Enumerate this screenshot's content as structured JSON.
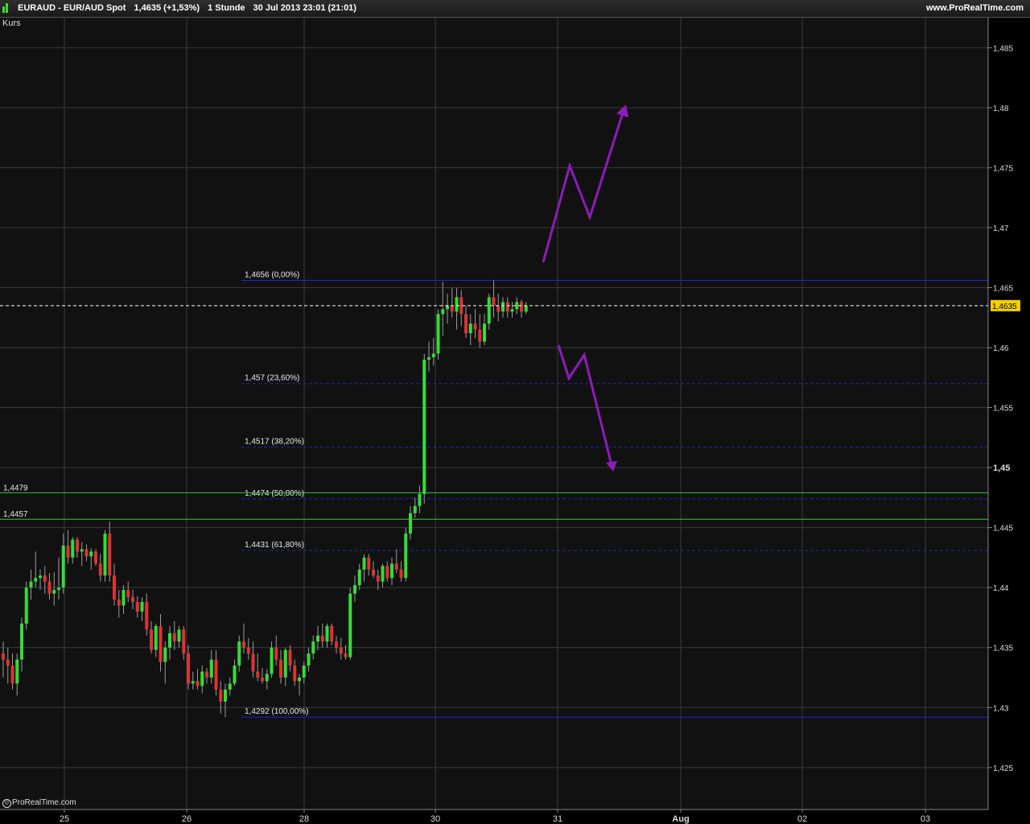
{
  "header": {
    "symbol": "EURAUD - EUR/AUD Spot",
    "last": "1,4635 (+1,53%)",
    "interval": "1 Stunde",
    "datetime": "30 Jul 2013 23:01 (21:01)",
    "site": "www.ProRealTime.com"
  },
  "panel_label": "Kurs",
  "watermark": "ProRealTime.com",
  "colors": {
    "up": "#33dd33",
    "down": "#dd3333",
    "fib": "#2222cc",
    "support": "#33cc33",
    "arrow": "#8c1cb8",
    "price_tag": "#f5d000"
  },
  "chart_data": {
    "type": "candlestick",
    "title": "EURAUD - EUR/AUD Spot",
    "ylabel": "Kurs",
    "ylim": [
      1.4215,
      1.4875
    ],
    "yticks": [
      "1,485",
      "1,48",
      "1,475",
      "1,47",
      "1,465",
      "1,46",
      "1,455",
      "1,45",
      "1,445",
      "1,44",
      "1,435",
      "1,43",
      "1,425"
    ],
    "ytick_values": [
      1.485,
      1.48,
      1.475,
      1.47,
      1.465,
      1.46,
      1.455,
      1.45,
      1.445,
      1.44,
      1.435,
      1.43,
      1.425
    ],
    "xticks": [
      "25",
      "26",
      "28",
      "30",
      "31",
      "Aug",
      "02",
      "03"
    ],
    "last_price": "1,4635",
    "last_price_value": 1.4635,
    "support_lines": [
      {
        "label": "1,4479",
        "value": 1.4479
      },
      {
        "label": "1,4457",
        "value": 1.4457
      }
    ],
    "fib_levels": [
      {
        "label": "1,4656 (0,00%)",
        "value": 1.4656
      },
      {
        "label": "1,457 (23,60%)",
        "value": 1.457
      },
      {
        "label": "1,4517 (38,20%)",
        "value": 1.4517
      },
      {
        "label": "1,4474 (50,00%)",
        "value": 1.4474
      },
      {
        "label": "1,4431 (61,80%)",
        "value": 1.4431
      },
      {
        "label": "1,4292 (100,00%)",
        "value": 1.4292
      }
    ],
    "candles": [
      [
        1.4345,
        1.4355,
        1.4325,
        1.434
      ],
      [
        1.434,
        1.435,
        1.432,
        1.4335
      ],
      [
        1.4335,
        1.4345,
        1.4315,
        1.432
      ],
      [
        1.432,
        1.4345,
        1.431,
        1.434
      ],
      [
        1.434,
        1.4375,
        1.433,
        1.437
      ],
      [
        1.437,
        1.4405,
        1.4365,
        1.44
      ],
      [
        1.44,
        1.4415,
        1.439,
        1.4405
      ],
      [
        1.4405,
        1.443,
        1.44,
        1.4408
      ],
      [
        1.4408,
        1.4415,
        1.4398,
        1.441
      ],
      [
        1.441,
        1.4418,
        1.4395,
        1.4405
      ],
      [
        1.4405,
        1.4412,
        1.439,
        1.4395
      ],
      [
        1.4395,
        1.4413,
        1.4385,
        1.4398
      ],
      [
        1.4398,
        1.4425,
        1.439,
        1.44
      ],
      [
        1.44,
        1.4445,
        1.4395,
        1.4435
      ],
      [
        1.4435,
        1.4448,
        1.442,
        1.4425
      ],
      [
        1.4425,
        1.4442,
        1.442,
        1.444
      ],
      [
        1.444,
        1.4442,
        1.4425,
        1.443
      ],
      [
        1.443,
        1.4438,
        1.4418,
        1.4432
      ],
      [
        1.4432,
        1.4436,
        1.4422,
        1.4426
      ],
      [
        1.4426,
        1.4433,
        1.4415,
        1.443
      ],
      [
        1.443,
        1.4432,
        1.4418,
        1.442
      ],
      [
        1.442,
        1.4428,
        1.4405,
        1.441
      ],
      [
        1.441,
        1.4448,
        1.4405,
        1.4445
      ],
      [
        1.4445,
        1.4455,
        1.4405,
        1.441
      ],
      [
        1.441,
        1.442,
        1.4385,
        1.439
      ],
      [
        1.439,
        1.4398,
        1.4375,
        1.4385
      ],
      [
        1.4385,
        1.4402,
        1.4378,
        1.4398
      ],
      [
        1.4398,
        1.4405,
        1.4388,
        1.4392
      ],
      [
        1.4392,
        1.4398,
        1.4382,
        1.4388
      ],
      [
        1.4388,
        1.4393,
        1.4375,
        1.438
      ],
      [
        1.438,
        1.4392,
        1.4372,
        1.4388
      ],
      [
        1.4388,
        1.4395,
        1.436,
        1.4365
      ],
      [
        1.4365,
        1.4372,
        1.4345,
        1.4348
      ],
      [
        1.4348,
        1.437,
        1.4342,
        1.4368
      ],
      [
        1.4368,
        1.4378,
        1.433,
        1.4338
      ],
      [
        1.4338,
        1.4355,
        1.432,
        1.435
      ],
      [
        1.435,
        1.4368,
        1.434,
        1.4362
      ],
      [
        1.4362,
        1.4372,
        1.4348,
        1.4355
      ],
      [
        1.4355,
        1.4368,
        1.435,
        1.4365
      ],
      [
        1.4365,
        1.4368,
        1.434,
        1.4345
      ],
      [
        1.4345,
        1.4352,
        1.4315,
        1.432
      ],
      [
        1.432,
        1.433,
        1.4315,
        1.4322
      ],
      [
        1.4322,
        1.4332,
        1.4315,
        1.4318
      ],
      [
        1.4318,
        1.4335,
        1.4312,
        1.433
      ],
      [
        1.433,
        1.4333,
        1.432,
        1.4325
      ],
      [
        1.4325,
        1.4348,
        1.432,
        1.434
      ],
      [
        1.434,
        1.4348,
        1.431,
        1.4315
      ],
      [
        1.4315,
        1.4322,
        1.4295,
        1.4305
      ],
      [
        1.4305,
        1.432,
        1.4292,
        1.4315
      ],
      [
        1.4315,
        1.4325,
        1.431,
        1.432
      ],
      [
        1.432,
        1.434,
        1.4318,
        1.4335
      ],
      [
        1.4335,
        1.436,
        1.433,
        1.4355
      ],
      [
        1.4355,
        1.437,
        1.4345,
        1.435
      ],
      [
        1.435,
        1.4358,
        1.434,
        1.4345
      ],
      [
        1.4345,
        1.4355,
        1.4325,
        1.433
      ],
      [
        1.433,
        1.4345,
        1.4322,
        1.4325
      ],
      [
        1.4325,
        1.4333,
        1.432,
        1.4322
      ],
      [
        1.4322,
        1.4332,
        1.4315,
        1.4328
      ],
      [
        1.4328,
        1.4355,
        1.4325,
        1.435
      ],
      [
        1.435,
        1.436,
        1.4335,
        1.434
      ],
      [
        1.434,
        1.4348,
        1.432,
        1.4325
      ],
      [
        1.4325,
        1.435,
        1.4318,
        1.4348
      ],
      [
        1.4348,
        1.4352,
        1.433,
        1.4335
      ],
      [
        1.4335,
        1.434,
        1.4318,
        1.4322
      ],
      [
        1.4322,
        1.4328,
        1.431,
        1.4325
      ],
      [
        1.4325,
        1.4338,
        1.432,
        1.4335
      ],
      [
        1.4335,
        1.435,
        1.433,
        1.4345
      ],
      [
        1.4345,
        1.436,
        1.434,
        1.4355
      ],
      [
        1.4355,
        1.4368,
        1.4348,
        1.436
      ],
      [
        1.436,
        1.437,
        1.435,
        1.4355
      ],
      [
        1.4355,
        1.437,
        1.435,
        1.4368
      ],
      [
        1.4368,
        1.437,
        1.4352,
        1.4355
      ],
      [
        1.4355,
        1.436,
        1.4345,
        1.435
      ],
      [
        1.435,
        1.4358,
        1.434,
        1.4345
      ],
      [
        1.4345,
        1.4352,
        1.434,
        1.4342
      ],
      [
        1.4342,
        1.44,
        1.434,
        1.4395
      ],
      [
        1.4395,
        1.441,
        1.4388,
        1.4402
      ],
      [
        1.4402,
        1.442,
        1.4398,
        1.4415
      ],
      [
        1.4415,
        1.4428,
        1.4405,
        1.4425
      ],
      [
        1.4425,
        1.4428,
        1.441,
        1.4415
      ],
      [
        1.4415,
        1.4422,
        1.4408,
        1.441
      ],
      [
        1.441,
        1.4415,
        1.4398,
        1.4405
      ],
      [
        1.4405,
        1.442,
        1.44,
        1.4418
      ],
      [
        1.4418,
        1.4422,
        1.4405,
        1.4408
      ],
      [
        1.4408,
        1.4425,
        1.4402,
        1.442
      ],
      [
        1.442,
        1.4432,
        1.4412,
        1.4415
      ],
      [
        1.4415,
        1.4422,
        1.4405,
        1.4408
      ],
      [
        1.4408,
        1.445,
        1.4405,
        1.4445
      ],
      [
        1.4445,
        1.4468,
        1.444,
        1.4462
      ],
      [
        1.4462,
        1.4475,
        1.4458,
        1.4468
      ],
      [
        1.4468,
        1.4485,
        1.4462,
        1.4478
      ],
      [
        1.4478,
        1.4595,
        1.447,
        1.459
      ],
      [
        1.459,
        1.4605,
        1.458,
        1.4592
      ],
      [
        1.4592,
        1.4608,
        1.4585,
        1.4595
      ],
      [
        1.4595,
        1.4632,
        1.459,
        1.4628
      ],
      [
        1.4628,
        1.4655,
        1.461,
        1.4632
      ],
      [
        1.4632,
        1.4645,
        1.462,
        1.4635
      ],
      [
        1.4635,
        1.465,
        1.4625,
        1.463
      ],
      [
        1.463,
        1.465,
        1.4615,
        1.4642
      ],
      [
        1.4642,
        1.4648,
        1.4618,
        1.4628
      ],
      [
        1.4628,
        1.4635,
        1.4608,
        1.4612
      ],
      [
        1.4612,
        1.4628,
        1.4602,
        1.462
      ],
      [
        1.462,
        1.4632,
        1.4608,
        1.4615
      ],
      [
        1.4615,
        1.4628,
        1.46,
        1.4605
      ],
      [
        1.4605,
        1.4628,
        1.4602,
        1.462
      ],
      [
        1.462,
        1.4645,
        1.4615,
        1.4642
      ],
      [
        1.4642,
        1.4656,
        1.4625,
        1.4635
      ],
      [
        1.4635,
        1.4645,
        1.4622,
        1.463
      ],
      [
        1.463,
        1.4642,
        1.4625,
        1.4638
      ],
      [
        1.4638,
        1.4642,
        1.4625,
        1.463
      ],
      [
        1.463,
        1.4638,
        1.4625,
        1.4632
      ],
      [
        1.4632,
        1.4642,
        1.4628,
        1.4638
      ],
      [
        1.4638,
        1.464,
        1.4625,
        1.463
      ],
      [
        1.463,
        1.4638,
        1.4628,
        1.4635
      ]
    ]
  }
}
